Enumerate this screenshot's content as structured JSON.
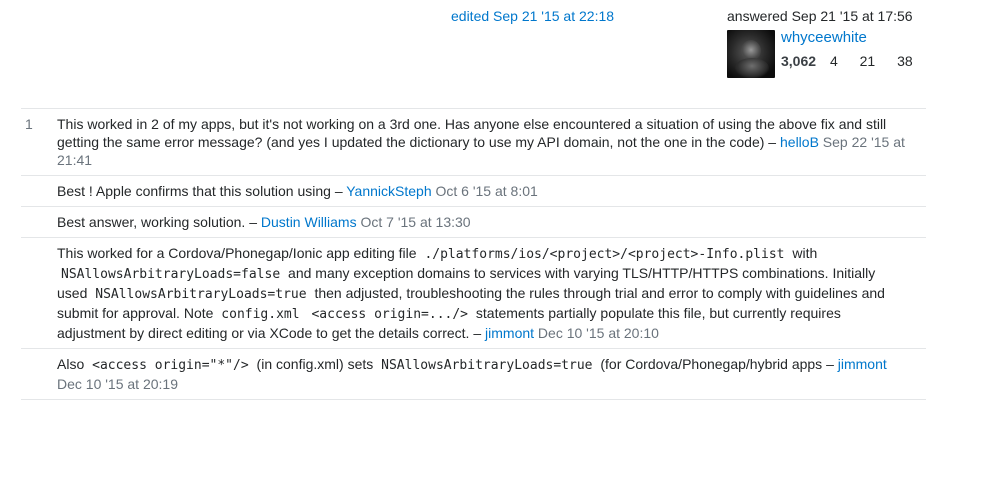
{
  "signature": {
    "edited": "edited Sep 21 '15 at 22:18",
    "answered": "answered Sep 21 '15 at 17:56",
    "user": {
      "name": "whyceewhite",
      "reputation": "3,062",
      "gold_badges": "4",
      "silver_badges": "21",
      "bronze_badges": "38"
    }
  },
  "comments": [
    {
      "score": "1",
      "text": "This worked in 2 of my apps, but it's not working on a 3rd one. Has anyone else encountered a situation of using the above fix and still getting the same error message? (and yes I updated the dictionary to use my API domain, not the one in the code)",
      "separator": " – ",
      "user": "helloB",
      "date": " Sep 22 '15 at 21:41"
    },
    {
      "score": "",
      "text": "Best ! Apple confirms that this solution using",
      "separator": " – ",
      "user": "YannickSteph",
      "date": " Oct 6 '15 at 8:01"
    },
    {
      "score": "",
      "text": "Best answer, working solution.",
      "separator": " – ",
      "user": "Dustin Williams",
      "date": " Oct 7 '15 at 13:30"
    },
    {
      "score": "",
      "parts": {
        "t1": "This worked for a Cordova/Phonegap/Ionic app editing file ",
        "c1": "./platforms/ios/<project>/<project>-Info.plist",
        "t2": " with ",
        "c2": "NSAllowsArbitraryLoads=false",
        "t3": " and many exception domains to services with varying TLS/HTTP/HTTPS combinations. Initially used ",
        "c3": "NSAllowsArbitraryLoads=true",
        "t4": " then adjusted, troubleshooting the rules through trial and error to comply with guidelines and submit for approval. Note ",
        "c4": "config.xml",
        "t5": " ",
        "c5": "<access origin=.../>",
        "t6": " statements partially populate this file, but currently requires adjustment by direct editing or via XCode to get the details correct."
      },
      "separator": " – ",
      "user": "jimmont",
      "date": " Dec 10 '15 at 20:10"
    },
    {
      "score": "",
      "parts": {
        "t1": "Also ",
        "c1": "<access origin=\"*\"/>",
        "t2": " (in config.xml) sets ",
        "c2": "NSAllowsArbitraryLoads=true",
        "t3": " (for Cordova/Phonegap/hybrid apps"
      },
      "separator": " – ",
      "user": "jimmont",
      "date": " Dec 10 '15 at 20:19"
    }
  ],
  "colors": {
    "link": "#0077cc",
    "text": "#242729",
    "muted": "#6a737c",
    "divider": "#e4e6e8"
  }
}
